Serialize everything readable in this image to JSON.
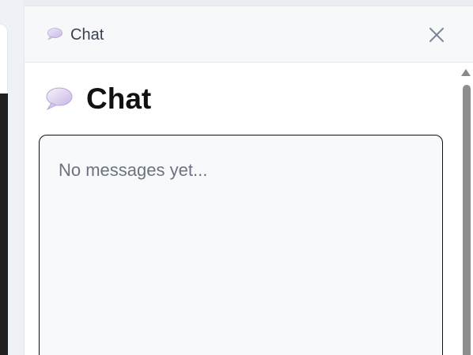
{
  "header": {
    "title": "Chat",
    "icon": "speech-bubble-icon"
  },
  "body": {
    "title": "Chat",
    "icon": "speech-bubble-icon"
  },
  "messages": {
    "empty_text": "No messages yet..."
  },
  "colors": {
    "panel_bg": "#ffffff",
    "header_bg": "#f7f8fa",
    "border": "#e5e7eb",
    "text_primary": "#111111",
    "text_muted": "#6b7280",
    "icon_bubble": "#d8cbe8"
  }
}
